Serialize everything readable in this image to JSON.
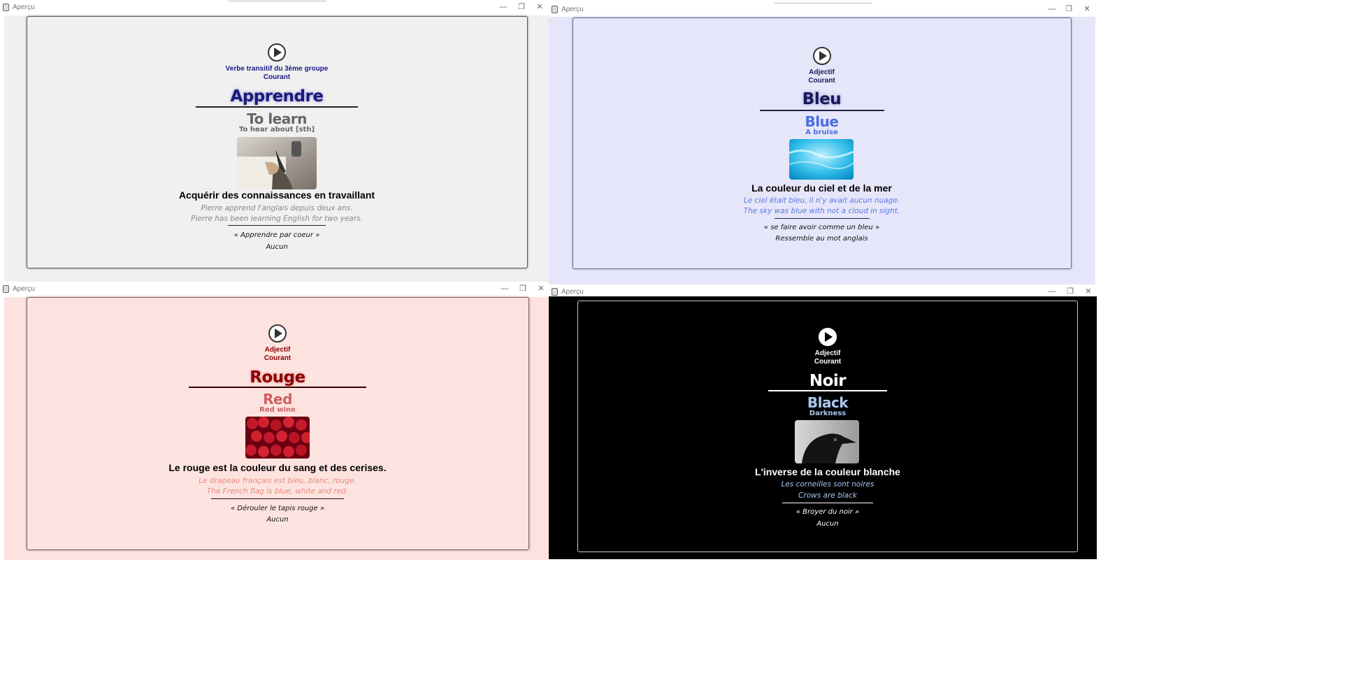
{
  "window_title": "Aperçu",
  "controls": {
    "minimize": "—",
    "maximize": "❐",
    "close": "✕"
  },
  "cards": [
    {
      "theme": {
        "bg": "#f0f0f0",
        "border": "#555555",
        "meta": "#1a1a8a",
        "word": "#1a1a7a",
        "line": "#222222",
        "trans": "#666666",
        "sub": "#666666",
        "def": "#000000",
        "ex": "#888888",
        "idiom": "#111111"
      },
      "category": "Verbe transitif du 3ème groupe",
      "register": "Courant",
      "word": "Apprendre",
      "translation": "To learn",
      "secondary": "To hear about [sth]",
      "image": "writing-hand-image",
      "definition": "Acquérir des connaissances en travaillant",
      "example_fr": "Pierre apprend l'anglais depuis deux ans.",
      "example_en": "Pierre has been learning English for two years.",
      "idiom": "« Apprendre par coeur »",
      "note": "Aucun"
    },
    {
      "theme": {
        "bg": "#e6e6fa",
        "border": "#6a6a9a",
        "meta": "#1a1a5a",
        "word": "#1a1a5a",
        "line": "#222244",
        "trans": "#4a6ee0",
        "sub": "#4a6ee0",
        "def": "#000000",
        "ex": "#5a7ae0",
        "idiom": "#111111"
      },
      "category": "Adjectif",
      "register": "Courant",
      "word": "Bleu",
      "translation": "Blue",
      "secondary": "A bruise",
      "image": "blue-water-image",
      "definition": "La couleur du ciel et de la mer",
      "example_fr": "Le ciel était bleu, il n'y avait aucun nuage.",
      "example_en": "The sky was blue with not a cloud in sight.",
      "idiom": "« se faire avoir comme un bleu »",
      "note": "Ressemble au mot anglais"
    },
    {
      "theme": {
        "bg": "#fde3e0",
        "border": "#8a5a5a",
        "meta": "#8b0000",
        "word": "#8b0000",
        "line": "#330000",
        "trans": "#d06060",
        "sub": "#d06060",
        "def": "#000000",
        "ex": "#e88a7a",
        "idiom": "#111111"
      },
      "category": "Adjectif",
      "register": "Courant",
      "word": "Rouge",
      "translation": "Red",
      "secondary": "Red wine",
      "image": "cherries-image",
      "definition": "Le rouge est la couleur du sang et des cerises.",
      "example_fr": "Le drapeau français est bleu, blanc, rouge.",
      "example_en": "The French flag is blue, white and red.",
      "idiom": "« Dérouler le tapis rouge »",
      "note": "Aucun"
    },
    {
      "theme": {
        "bg": "#000000",
        "border": "#cccccc",
        "meta": "#ffffff",
        "word": "#ffffff",
        "line": "#ffffff",
        "trans": "#a8c8f0",
        "sub": "#a8c8f0",
        "def": "#ffffff",
        "ex": "#a8c8f0",
        "idiom": "#ffffff"
      },
      "category": "Adjectif",
      "register": "Courant",
      "word": "Noir",
      "translation": "Black",
      "secondary": "Darkness",
      "image": "crow-image",
      "definition": "L'inverse de la couleur blanche",
      "example_fr": "Les corneilles sont noires",
      "example_en": "Crows are black",
      "idiom": "« Broyer du noir »",
      "note": "Aucun"
    }
  ]
}
